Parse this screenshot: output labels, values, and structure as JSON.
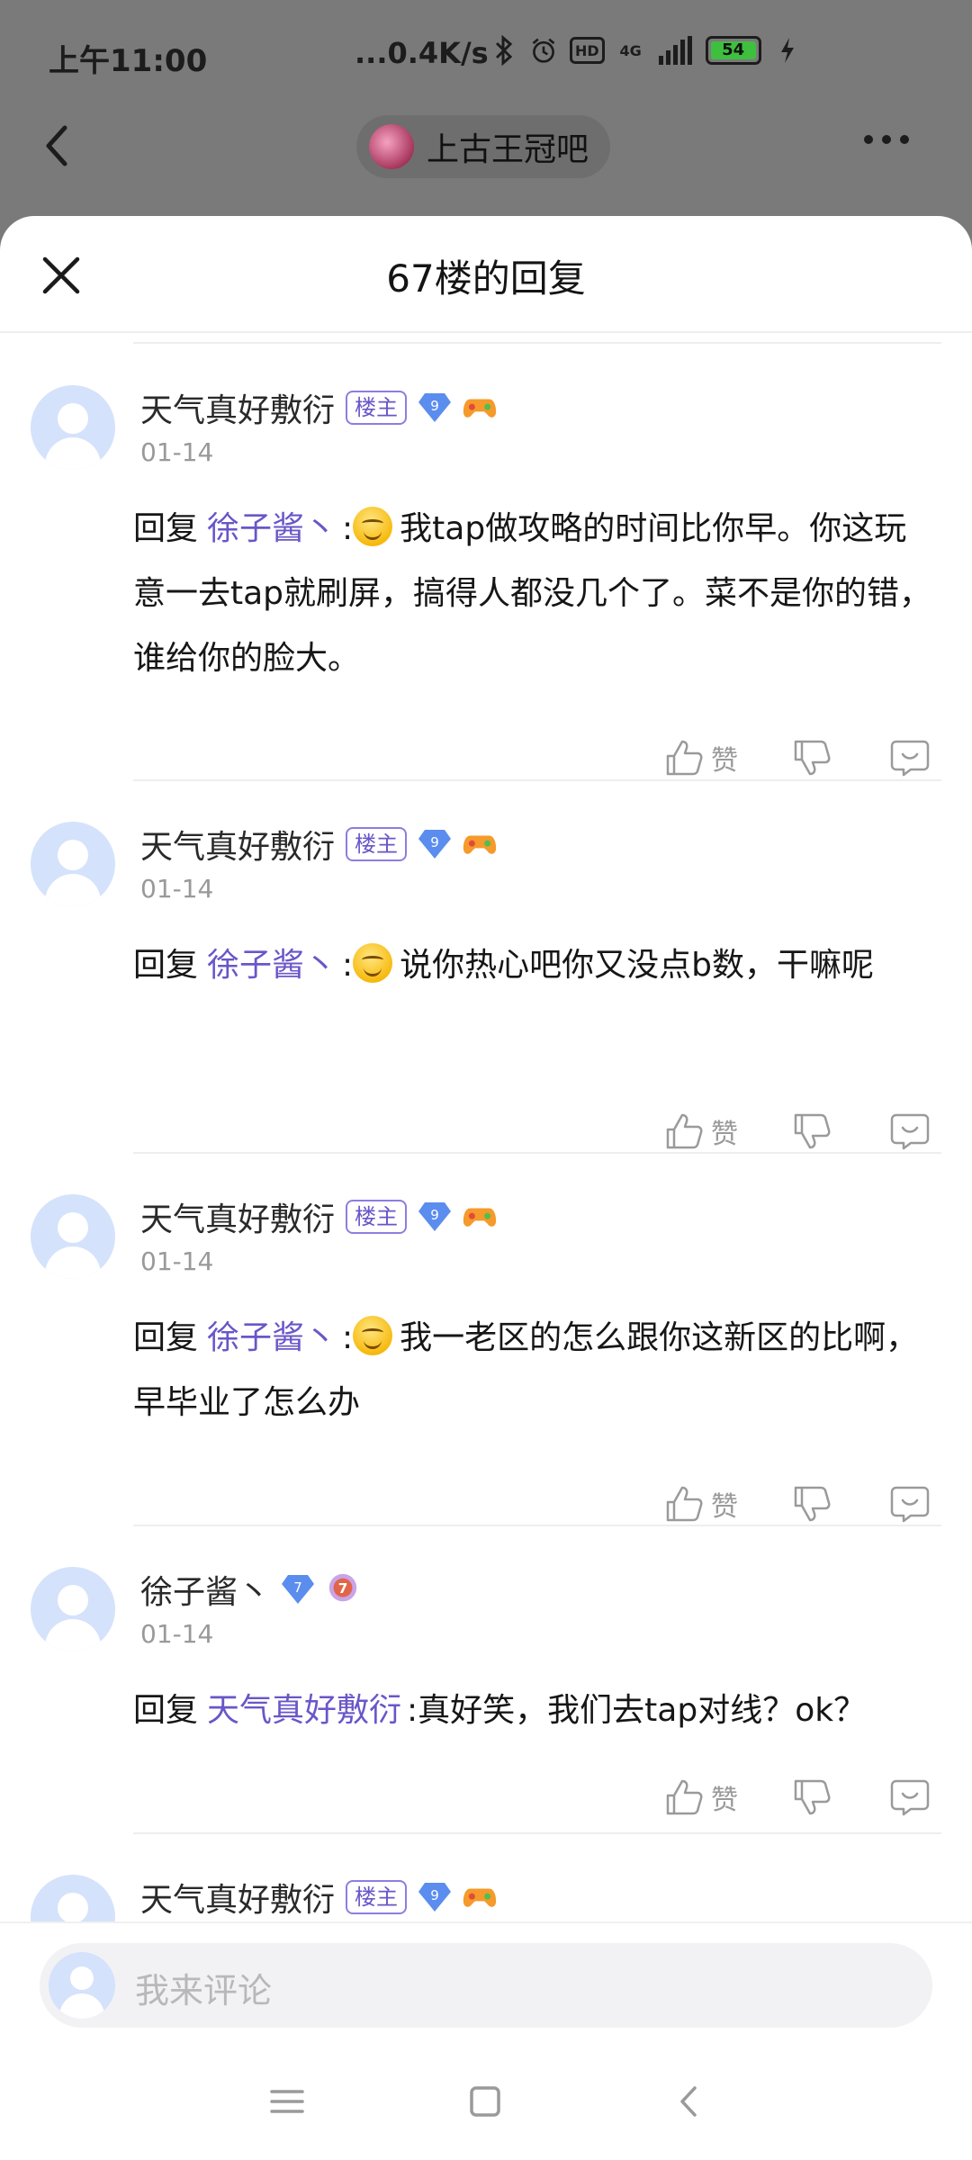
{
  "status_bar": {
    "time": "上午11:00",
    "speed": "...0.4K/s",
    "battery": "54",
    "network": "4G",
    "hd": "HD"
  },
  "header": {
    "forum_name": "上古王冠吧"
  },
  "sheet": {
    "title": "67楼的回复"
  },
  "labels": {
    "louzhu": "楼主",
    "reply": "回复",
    "like": "赞"
  },
  "comments": [
    {
      "user": "天气真好敷衍",
      "level": "9",
      "date": "01-14",
      "reply_to": "徐子酱丶",
      "text": "我tap做攻略的时间比你早。你这玩意一去tap就刷屏，搞得人都没几个了。菜不是你的错，谁给你的脸大。"
    },
    {
      "user": "天气真好敷衍",
      "level": "9",
      "date": "01-14",
      "reply_to": "徐子酱丶",
      "text": "说你热心吧你又没点b数，干嘛呢"
    },
    {
      "user": "天气真好敷衍",
      "level": "9",
      "date": "01-14",
      "reply_to": "徐子酱丶",
      "text": "我一老区的怎么跟你这新区的比啊，早毕业了怎么办"
    },
    {
      "user": "徐子酱丶",
      "level": "7",
      "date": "01-14",
      "reply_to": "天气真好敷衍",
      "text": "真好笑，我们去tap对线？ok？"
    },
    {
      "user": "天气真好敷衍",
      "level": "9"
    }
  ],
  "comment_box": {
    "placeholder": "我来评论"
  },
  "colors": {
    "accent": "#6a56c8",
    "level_badge": "#5b8def",
    "avatar_bg": "#d5e2fb"
  }
}
